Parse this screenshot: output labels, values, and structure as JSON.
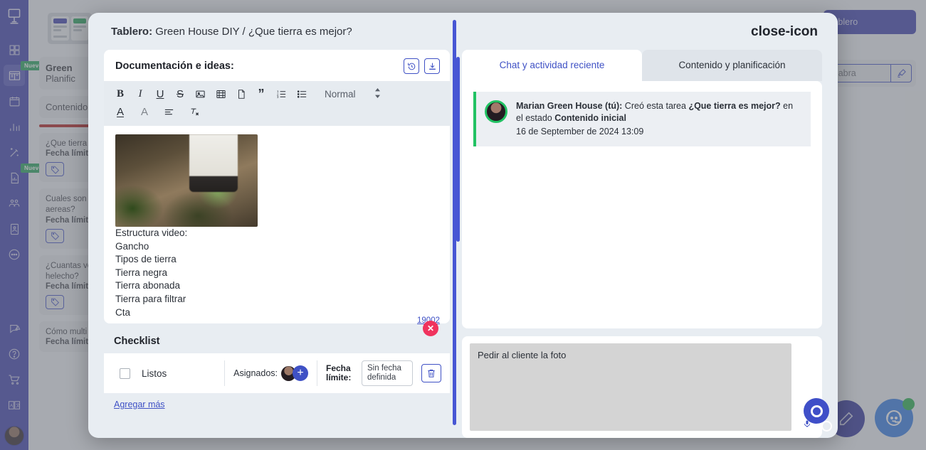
{
  "background": {
    "rail": {
      "items": [
        {
          "name": "logo",
          "icon": "podium-logo-icon",
          "badge": ""
        },
        {
          "name": "grid",
          "icon": "grid-icon",
          "badge": ""
        },
        {
          "name": "board",
          "icon": "board-icon",
          "badge": "Nuevo"
        },
        {
          "name": "calendar",
          "icon": "calendar-icon",
          "badge": ""
        },
        {
          "name": "stats",
          "icon": "bar-chart-icon",
          "badge": ""
        },
        {
          "name": "magic",
          "icon": "magic-wand-icon",
          "badge": ""
        },
        {
          "name": "report",
          "icon": "report-icon",
          "badge": "Nuevo"
        },
        {
          "name": "team",
          "icon": "team-icon",
          "badge": ""
        },
        {
          "name": "contact",
          "icon": "contact-card-icon",
          "badge": ""
        },
        {
          "name": "chat",
          "icon": "chat-bubble-icon",
          "badge": ""
        }
      ],
      "bottom_items": [
        {
          "name": "feedback",
          "icon": "feedback-icon"
        },
        {
          "name": "help",
          "icon": "question-circle-icon"
        },
        {
          "name": "cart",
          "icon": "shopping-cart-icon"
        },
        {
          "name": "language",
          "icon": "language-icon"
        }
      ]
    },
    "board_column": {
      "board_title": "Green",
      "board_subtitle": "Planific",
      "list_name": "Contenido",
      "cards": [
        {
          "title": "¿Que tierra e",
          "meta": "Fecha límite:"
        },
        {
          "title": "Cuales son l\naereas?",
          "meta": "Fecha límite:"
        },
        {
          "title": "¿Cuantas ve\nhelecho?",
          "meta": "Fecha límite:"
        },
        {
          "title": "Cómo multi",
          "meta": "Fecha límite:"
        }
      ]
    },
    "right_widgets": {
      "board_button": "tablero",
      "search_placeholder": "alabra",
      "brush_icon": "brush-icon"
    },
    "fabs": {
      "edit_icon": "pencil-icon",
      "support_icon": "support-agent-icon",
      "status": "online"
    }
  },
  "modal": {
    "header": {
      "label": "Tablero:",
      "path": "Green House DIY / ¿Que tierra es mejor?",
      "close_icon": "close-icon"
    },
    "document": {
      "title": "Documentación e ideas:",
      "actions": [
        {
          "name": "history",
          "icon": "history-icon"
        },
        {
          "name": "download",
          "icon": "download-icon"
        }
      ],
      "toolbar": {
        "row1": [
          {
            "name": "bold",
            "glyph": "B",
            "icon": "bold-icon"
          },
          {
            "name": "italic",
            "glyph": "I",
            "icon": "italic-icon"
          },
          {
            "name": "underline",
            "glyph": "U",
            "icon": "underline-icon"
          },
          {
            "name": "strikethrough",
            "glyph": "S",
            "icon": "strikethrough-icon"
          },
          {
            "name": "image",
            "glyph": "",
            "icon": "image-icon"
          },
          {
            "name": "video",
            "glyph": "",
            "icon": "video-icon"
          },
          {
            "name": "file",
            "glyph": "",
            "icon": "file-icon"
          },
          {
            "name": "quote",
            "glyph": "",
            "icon": "quote-icon"
          },
          {
            "name": "ordered-list",
            "glyph": "",
            "icon": "ordered-list-icon"
          },
          {
            "name": "bullet-list",
            "glyph": "",
            "icon": "bullet-list-icon"
          }
        ],
        "style_value": "Normal",
        "row2": [
          {
            "name": "font-color",
            "glyph": "A",
            "icon": "font-color-icon"
          },
          {
            "name": "highlight",
            "glyph": "A",
            "icon": "highlight-icon"
          },
          {
            "name": "align",
            "glyph": "",
            "icon": "align-icon"
          },
          {
            "name": "clear-format",
            "glyph": "",
            "icon": "clear-format-icon"
          }
        ]
      },
      "image_alt": "gardening-hands-planting-photo",
      "lines": [
        "Estructura video:",
        "Gancho",
        "Tipos de tierra",
        "Tierra negra",
        "Tierra abonada",
        "Tierra para filtrar",
        "Cta"
      ],
      "char_count": "19002",
      "error_badge": "✕"
    },
    "checklist": {
      "title": "Checklist",
      "item_label": "Listos",
      "assignees_label": "Asignados:",
      "add_icon": "plus-icon",
      "due_label": "Fecha límite:",
      "due_value": "Sin fecha definida",
      "delete_icon": "trash-icon",
      "add_more": "Agregar más"
    },
    "tabs": [
      {
        "label": "Chat y actividad reciente",
        "active": true
      },
      {
        "label": "Contenido y planificación",
        "active": false
      }
    ],
    "activity": [
      {
        "author": "Marian Green House (tú):",
        "action_pre": " Creó esta tarea ",
        "task": "¿Que tierra es mejor?",
        "action_mid": " en el estado ",
        "status": "Contenido inicial",
        "date": "16 de September de 2024 13:09"
      }
    ],
    "chat": {
      "message": "Pedir al cliente la foto",
      "mic_icon": "microphone-icon",
      "record_icon": "record-ring-icon",
      "send_icon": "send-ring-icon"
    }
  },
  "colors": {
    "primary": "#3f51c5",
    "rail": "#3b3fae",
    "green": "#22c263",
    "danger": "#f0335e",
    "red_rule": "#b01c1c"
  }
}
